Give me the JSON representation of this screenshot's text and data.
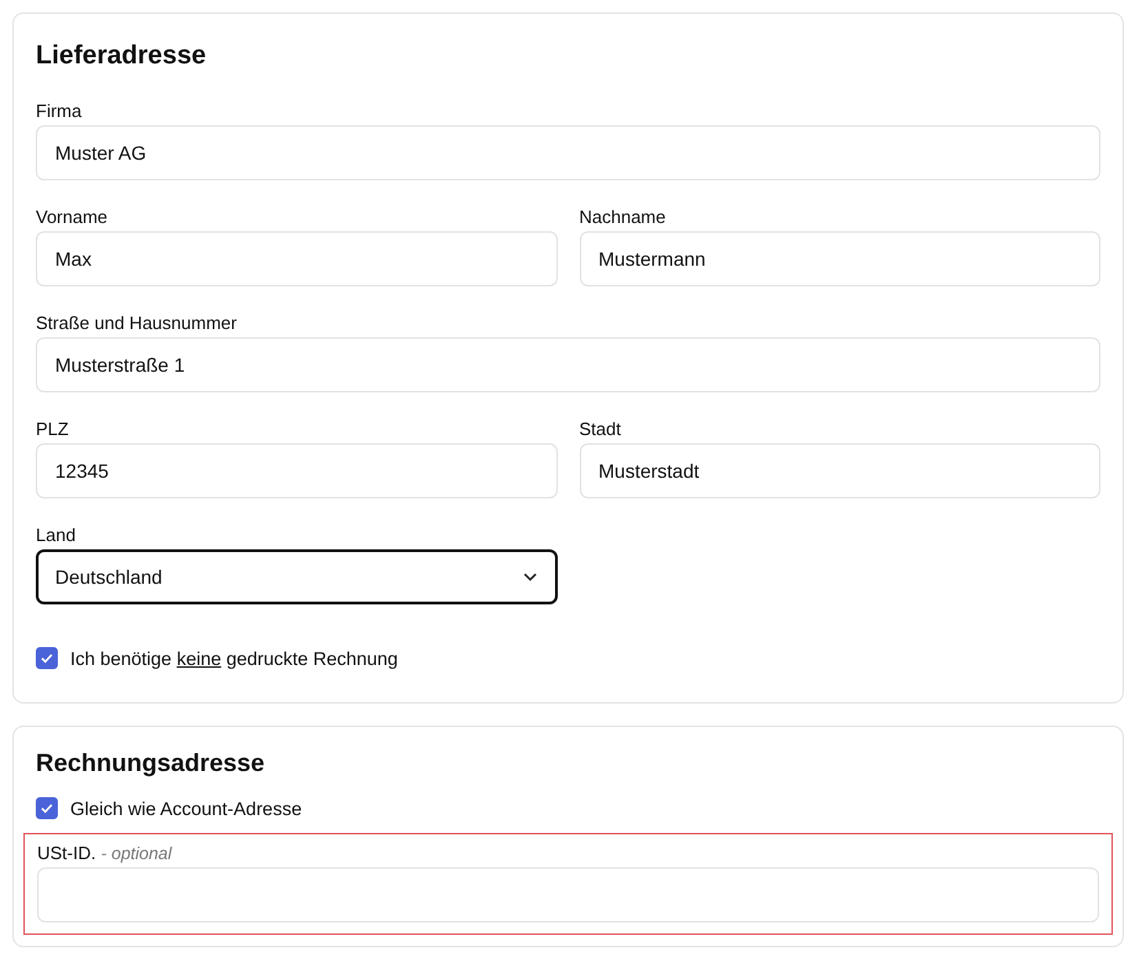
{
  "delivery": {
    "title": "Lieferadresse",
    "rows": [
      [
        {
          "label": "Firma",
          "value": "Muster AG",
          "kind": "text",
          "focused": false
        }
      ],
      [
        {
          "label": "Vorname",
          "value": "Max",
          "kind": "text",
          "focused": false
        },
        {
          "label": "Nachname",
          "value": "Mustermann",
          "kind": "text",
          "focused": false
        }
      ],
      [
        {
          "label": "Straße und Hausnummer",
          "value": "Musterstraße 1",
          "kind": "text",
          "focused": false
        }
      ],
      [
        {
          "label": "PLZ",
          "value": "12345",
          "kind": "text",
          "focused": false
        },
        {
          "label": "Stadt",
          "value": "Musterstadt",
          "kind": "text",
          "focused": false
        }
      ],
      [
        {
          "label": "Land",
          "value": "Deutschland",
          "kind": "select",
          "focused": true
        }
      ]
    ],
    "checkbox": {
      "before": "Ich benötige",
      "underlined": "keine",
      "after": "gedruckte Rechnung",
      "checked": true
    }
  },
  "billing": {
    "title": "Rechnungsadresse",
    "checkbox": {
      "label": "Gleich wie Account-Adresse",
      "checked": true
    },
    "vat": {
      "label": "USt-ID.",
      "hint": "- optional",
      "highlighted": true
    }
  }
}
